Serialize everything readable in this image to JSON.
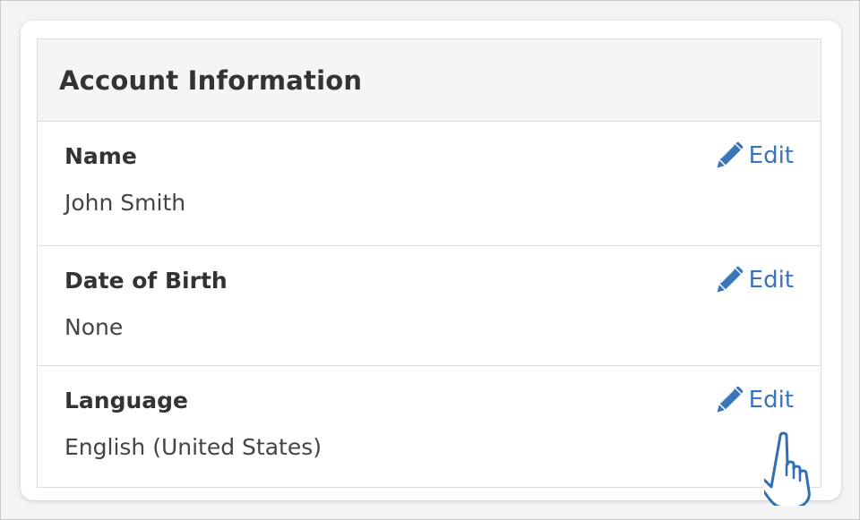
{
  "panel": {
    "title": "Account Information"
  },
  "fields": [
    {
      "label": "Name",
      "value": "John Smith",
      "edit_label": "Edit",
      "edit_icon": "pencil-icon"
    },
    {
      "label": "Date of Birth",
      "value": "None",
      "edit_label": "Edit",
      "edit_icon": "pencil-icon"
    },
    {
      "label": "Language",
      "value": "English (United States)",
      "edit_label": "Edit",
      "edit_icon": "pencil-icon"
    }
  ],
  "cursor": {
    "icon": "hand-pointer-icon"
  },
  "colors": {
    "accent": "#3a74b9",
    "text": "#333333",
    "header_bg": "#f5f5f5",
    "border": "#dddddd"
  }
}
